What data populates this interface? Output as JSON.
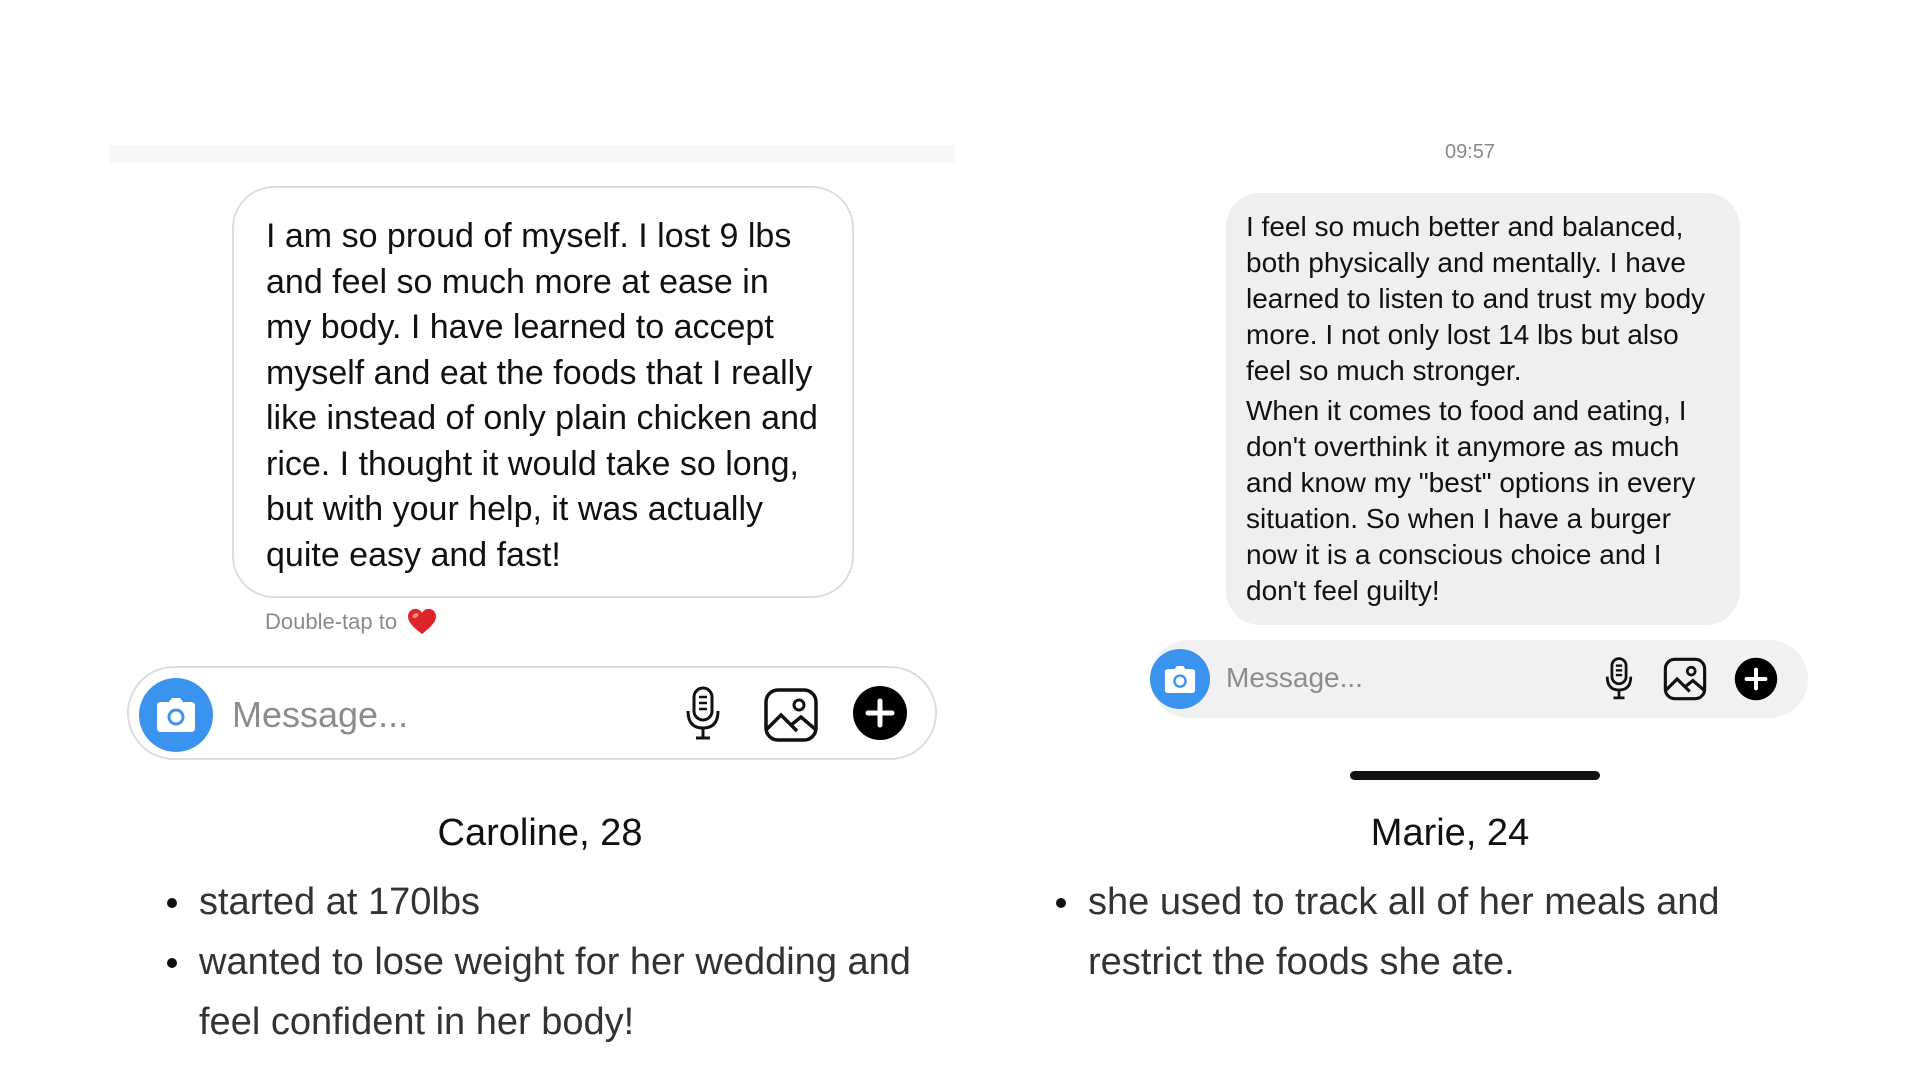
{
  "left": {
    "message": "I am so proud of myself. I lost 9 lbs and feel so much more at ease in my body. I have learned to accept myself and eat the foods that I really like instead of only plain chicken and rice. I thought it would take so long, but with your help, it was actually quite easy and fast!",
    "double_tap_text": "Double-tap to",
    "input_placeholder": "Message...",
    "name": "Caroline, 28",
    "bullets": [
      "started at 170lbs",
      "wanted to lose weight for her wedding and feel confident in her body!"
    ]
  },
  "right": {
    "timestamp": "09:57",
    "message_paragraph_1": "I feel so much better and balanced, both physically and mentally. I have learned to listen to and trust my body more. I not only lost 14 lbs but also feel so much stronger.",
    "message_paragraph_2": "When it comes to food and eating, I don't overthink it anymore as much and know my \"best\" options in every situation. So when I have a burger now it is a conscious choice and I don't feel guilty!",
    "input_placeholder": "Message...",
    "name": "Marie, 24",
    "bullets": [
      "she used to track all of her meals and restrict the foods she ate."
    ]
  },
  "colors": {
    "camera_blue": "#3b93f0",
    "heart_red": "#e0242b",
    "bubble_gray": "#efefef"
  },
  "icons": [
    "camera-icon",
    "microphone-icon",
    "gallery-icon",
    "plus-icon",
    "heart-icon"
  ]
}
